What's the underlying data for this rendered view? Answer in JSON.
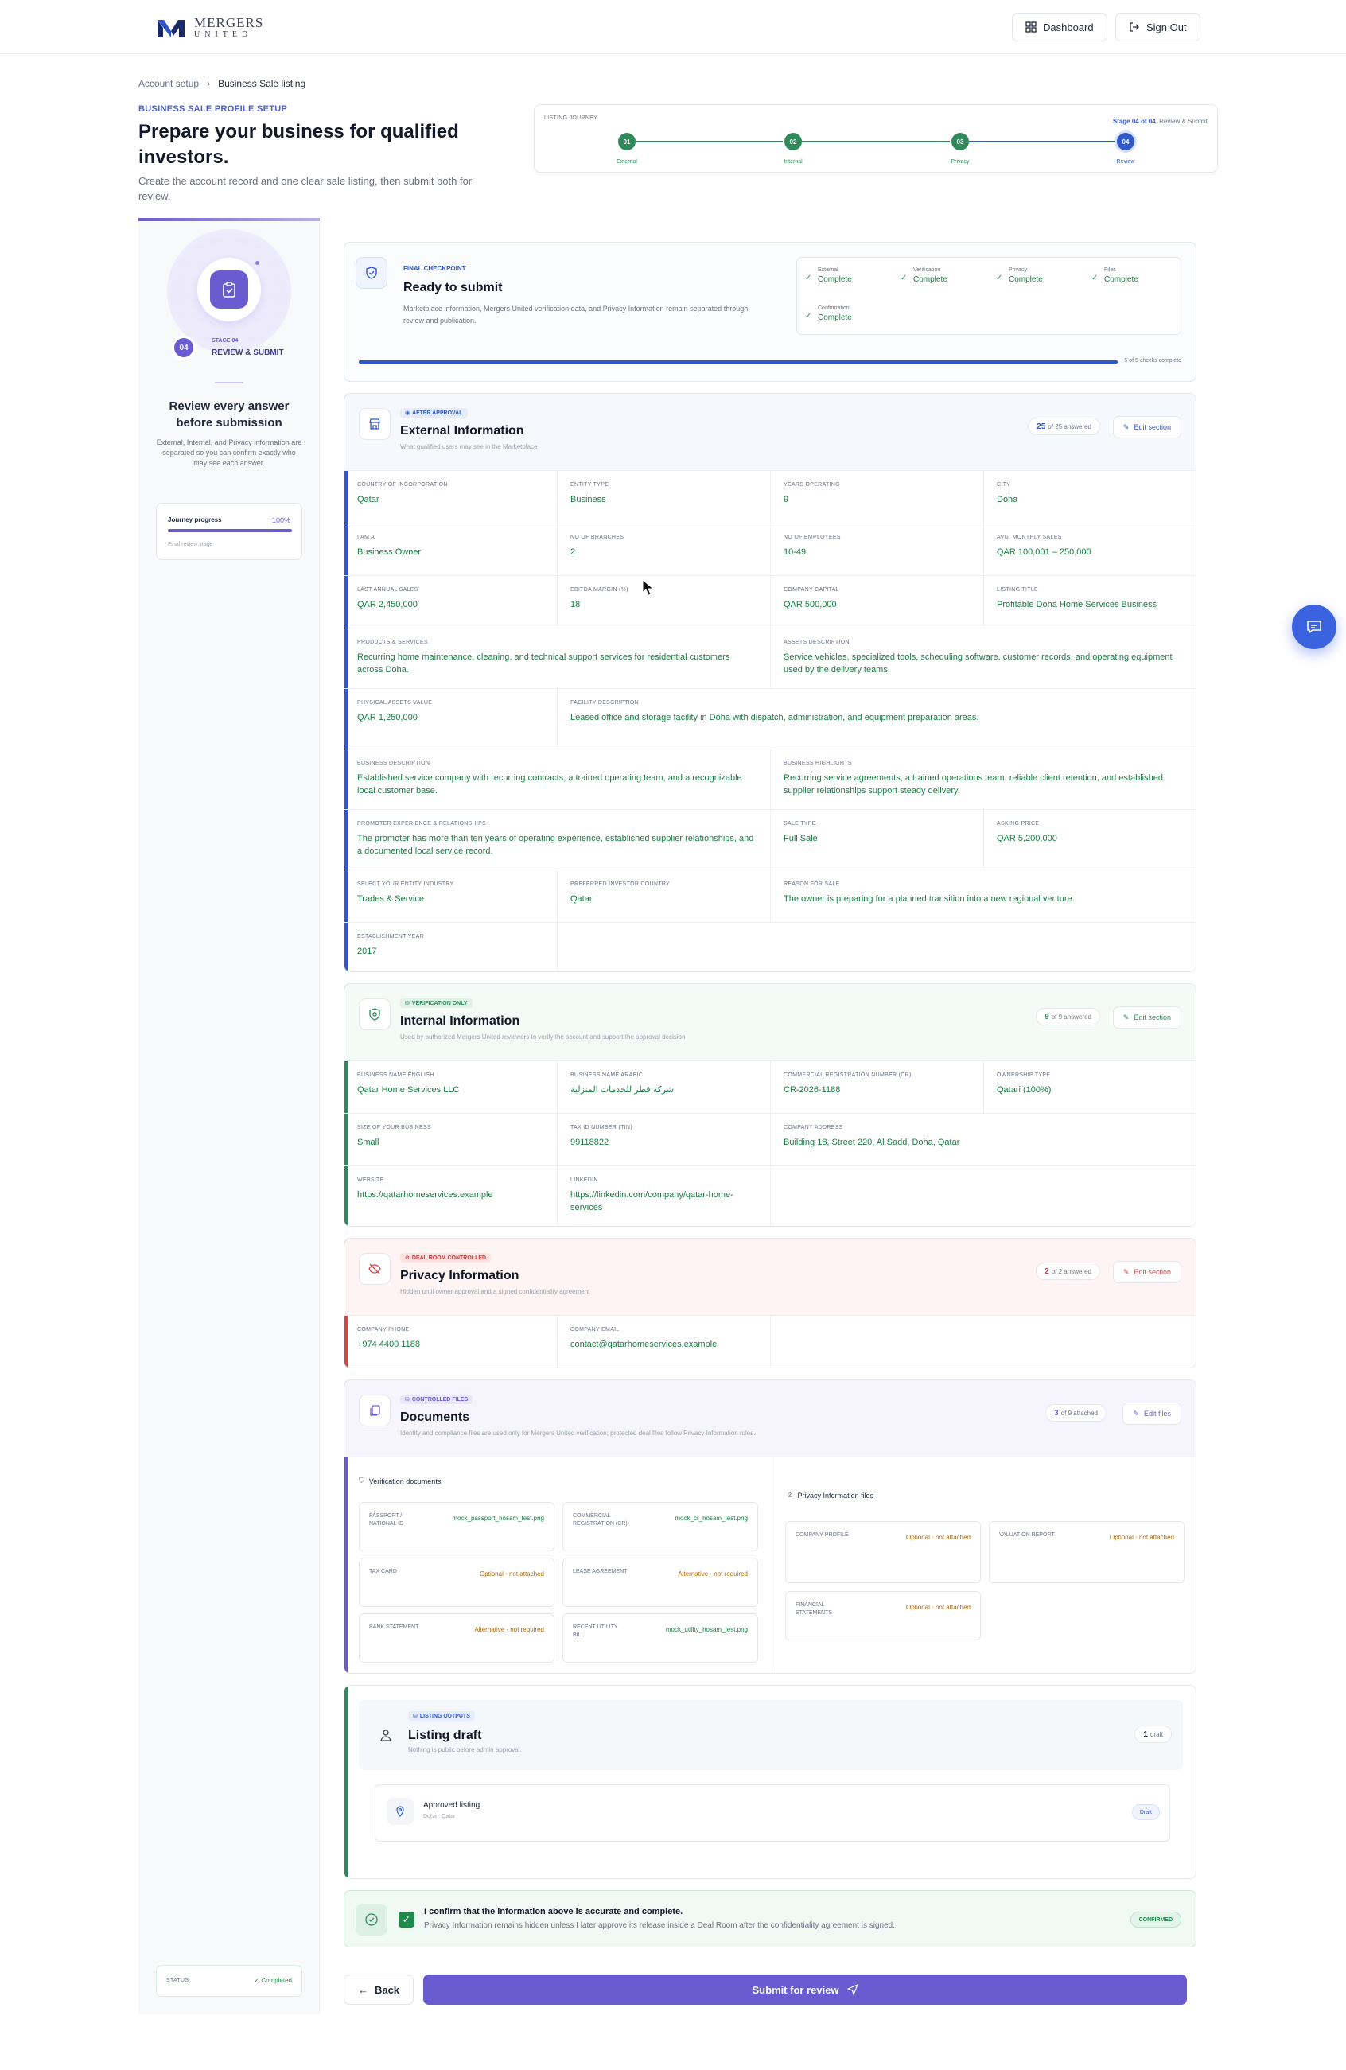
{
  "brand": {
    "line1": "MERGERS",
    "line2": "UNITED"
  },
  "topbar": {
    "dashboard": "Dashboard",
    "signout": "Sign Out"
  },
  "breadcrumb": {
    "parent": "Account setup",
    "current": "Business Sale listing"
  },
  "header": {
    "eyebrow": "BUSINESS SALE PROFILE SETUP",
    "title": "Prepare your business for qualified investors.",
    "subtitle": "Create the account record and one clear sale listing, then submit both for review."
  },
  "journey": {
    "label": "LISTING JOURNEY",
    "stage_text": "Stage 04 of 04",
    "stage_name": "Review & Submit",
    "steps": [
      {
        "num": "01",
        "label": "External"
      },
      {
        "num": "02",
        "label": "Internal"
      },
      {
        "num": "03",
        "label": "Privacy"
      },
      {
        "num": "04",
        "label": "Review"
      }
    ]
  },
  "sidebar": {
    "stage_small": "STAGE 04",
    "stage_num": "04",
    "stage_label": "REVIEW & SUBMIT",
    "heading": "Review every answer before submission",
    "text": "External, Internal, and Privacy information are separated so you can confirm exactly who may see each answer.",
    "progress_label": "Journey progress",
    "progress_value": "100%",
    "progress_fraction": 1.0,
    "progress_note": "Final review stage",
    "status_label": "STATUS",
    "status_value": "Completed"
  },
  "checkpoint": {
    "eyebrow": "FINAL CHECKPOINT",
    "title": "Ready to submit",
    "text": "Marketplace information, Mergers United verification data, and Privacy Information remain separated through review and publication.",
    "checks": [
      {
        "label": "External",
        "value": "Complete"
      },
      {
        "label": "Verification",
        "value": "Complete"
      },
      {
        "label": "Privacy",
        "value": "Complete"
      },
      {
        "label": "Files",
        "value": "Complete"
      },
      {
        "label": "Confirmation",
        "value": "Complete"
      }
    ],
    "progress_text": "5 of 5 checks complete",
    "progress_fraction": 1.0
  },
  "external": {
    "badge": "AFTER APPROVAL",
    "title": "External Information",
    "subtitle": "What qualified users may see in the Marketplace",
    "count_num": "25",
    "count_text": "of 25 answered",
    "edit": "Edit section",
    "fields": [
      {
        "k": "COUNTRY OF INCORPORATION",
        "v": "Qatar"
      },
      {
        "k": "ENTITY TYPE",
        "v": "Business"
      },
      {
        "k": "YEARS OPERATING",
        "v": "9"
      },
      {
        "k": "CITY",
        "v": "Doha"
      },
      {
        "k": "I AM A",
        "v": "Business Owner"
      },
      {
        "k": "NO OF BRANCHES",
        "v": "2"
      },
      {
        "k": "NO OF EMPLOYEES",
        "v": "10-49"
      },
      {
        "k": "AVG. MONTHLY SALES",
        "v": "QAR 100,001 – 250,000"
      },
      {
        "k": "LAST ANNUAL SALES",
        "v": "QAR 2,450,000"
      },
      {
        "k": "EBITDA MARGIN (%)",
        "v": "18"
      },
      {
        "k": "COMPANY CAPITAL",
        "v": "QAR 500,000"
      },
      {
        "k": "LISTING TITLE",
        "v": "Profitable Doha Home Services Business"
      },
      {
        "k": "PRODUCTS & SERVICES",
        "v": "Recurring home maintenance, cleaning, and technical support services for residential customers across Doha."
      },
      {
        "k": "ASSETS DESCRIPTION",
        "v": "Service vehicles, specialized tools, scheduling software, customer records, and operating equipment used by the delivery teams."
      },
      {
        "k": "PHYSICAL ASSETS VALUE",
        "v": "QAR 1,250,000"
      },
      {
        "k": "FACILITY DESCRIPTION",
        "v": "Leased office and storage facility in Doha with dispatch, administration, and equipment preparation areas."
      },
      {
        "k": "BUSINESS DESCRIPTION",
        "v": "Established service company with recurring contracts, a trained operating team, and a recognizable local customer base."
      },
      {
        "k": "BUSINESS HIGHLIGHTS",
        "v": "Recurring service agreements, a trained operations team, reliable client retention, and established supplier relationships support steady delivery."
      },
      {
        "k": "PROMOTER EXPERIENCE & RELATIONSHIPS",
        "v": "The promoter has more than ten years of operating experience, established supplier relationships, and a documented local service record."
      },
      {
        "k": "SALE TYPE",
        "v": "Full Sale"
      },
      {
        "k": "ASKING PRICE",
        "v": "QAR 5,200,000"
      },
      {
        "k": "SELECT YOUR ENTITY INDUSTRY",
        "v": "Trades & Service"
      },
      {
        "k": "PREFERRED INVESTOR COUNTRY",
        "v": "Qatar"
      },
      {
        "k": "REASON FOR SALE",
        "v": "The owner is preparing for a planned transition into a new regional venture."
      },
      {
        "k": "ESTABLISHMENT YEAR",
        "v": "2017"
      }
    ]
  },
  "internal": {
    "badge": "VERIFICATION ONLY",
    "title": "Internal Information",
    "subtitle": "Used by authorized Mergers United reviewers to verify the account and support the approval decision",
    "count_num": "9",
    "count_text": "of 9 answered",
    "edit": "Edit section",
    "fields": [
      {
        "k": "BUSINESS NAME ENGLISH",
        "v": "Qatar Home Services LLC"
      },
      {
        "k": "BUSINESS NAME ARABIC",
        "v": "شركة قطر للخدمات المنزلية"
      },
      {
        "k": "COMMERCIAL REGISTRATION NUMBER (CR)",
        "v": "CR-2026-1188"
      },
      {
        "k": "OWNERSHIP TYPE",
        "v": "Qatari (100%)"
      },
      {
        "k": "SIZE OF YOUR BUSINESS",
        "v": "Small"
      },
      {
        "k": "TAX ID NUMBER (TIN)",
        "v": "99118822"
      },
      {
        "k": "COMPANY ADDRESS",
        "v": "Building 18, Street 220, Al Sadd, Doha, Qatar"
      },
      {
        "k": "WEBSITE",
        "v": "https://qatarhomeservices.example"
      },
      {
        "k": "LINKEDIN",
        "v": "https://linkedin.com/company/qatar-home-services"
      }
    ]
  },
  "privacy": {
    "badge": "DEAL ROOM CONTROLLED",
    "title": "Privacy Information",
    "subtitle": "Hidden until owner approval and a signed confidentiality agreement",
    "count_num": "2",
    "count_text": "of 2 answered",
    "edit": "Edit section",
    "fields": [
      {
        "k": "COMPANY PHONE",
        "v": "+974 4400 1188"
      },
      {
        "k": "COMPANY EMAIL",
        "v": "contact@qatarhomeservices.example"
      }
    ]
  },
  "documents": {
    "badge": "CONTROLLED FILES",
    "title": "Documents",
    "subtitle": "Identity and compliance files are used only for Mergers United verification; protected deal files follow Privacy Information rules.",
    "count_num": "3",
    "count_text": "of 9 attached",
    "edit": "Edit files",
    "verification_title": "Verification documents",
    "privacy_title": "Privacy Information files",
    "verification": [
      {
        "k": "PASSPORT / NATIONAL ID",
        "v": "mock_passport_hosam_test.png"
      },
      {
        "k": "COMMERCIAL REGISTRATION (CR)",
        "v": "mock_cr_hosam_test.png"
      },
      {
        "k": "TAX CARD",
        "v": "Optional · not attached"
      },
      {
        "k": "LEASE AGREEMENT",
        "v": "Alternative · not required"
      },
      {
        "k": "BANK STATEMENT",
        "v": "Alternative · not required"
      },
      {
        "k": "RECENT UTILITY BILL",
        "v": "mock_utility_hosam_test.png"
      }
    ],
    "privacy_files": [
      {
        "k": "COMPANY PROFILE",
        "v": "Optional · not attached"
      },
      {
        "k": "VALUATION REPORT",
        "v": "Optional · not attached"
      },
      {
        "k": "FINANCIAL STATEMENTS",
        "v": "Optional · not attached"
      }
    ]
  },
  "listing": {
    "badge": "LISTING OUTPUTS",
    "title": "Listing draft",
    "subtitle": "Nothing is public before admin approval.",
    "count_num": "1",
    "count_text": "draft",
    "item_title": "Approved listing",
    "item_sub": "Doha · Qatar",
    "item_badge": "Draft"
  },
  "confirm": {
    "title": "I confirm that the information above is accurate and complete.",
    "text": "Privacy Information remains hidden unless I later approve its release inside a Deal Room after the confidentiality agreement is signed.",
    "badge": "CONFIRMED"
  },
  "actions": {
    "back": "Back",
    "submit": "Submit for review"
  },
  "colors": {
    "accent": "#6a5bd1",
    "blue": "#3158c9",
    "green": "#1c7c45",
    "red": "#d64545"
  }
}
